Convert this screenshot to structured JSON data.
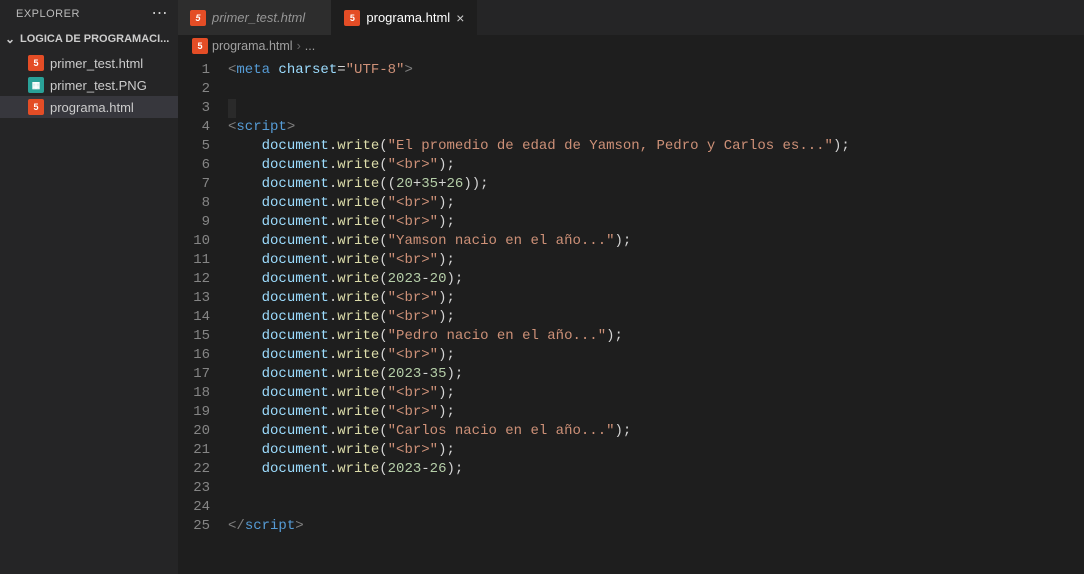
{
  "sidebar": {
    "title": "EXPLORER",
    "section": "LOGICA DE PROGRAMACI...",
    "items": [
      {
        "label": "primer_test.html",
        "icon": "html"
      },
      {
        "label": "primer_test.PNG",
        "icon": "img"
      },
      {
        "label": "programa.html",
        "icon": "html",
        "selected": true
      }
    ]
  },
  "tabs": [
    {
      "label": "primer_test.html",
      "icon": "html",
      "active": false
    },
    {
      "label": "programa.html",
      "icon": "html",
      "active": true
    }
  ],
  "breadcrumb": {
    "file": "programa.html",
    "tail": "..."
  },
  "code": {
    "lines": [
      [
        {
          "t": "punc",
          "v": "<"
        },
        {
          "t": "tag",
          "v": "meta"
        },
        {
          "t": "wh",
          "v": " "
        },
        {
          "t": "attr",
          "v": "charset"
        },
        {
          "t": "white",
          "v": "="
        },
        {
          "t": "str",
          "v": "\"UTF-8\""
        },
        {
          "t": "punc",
          "v": ">"
        }
      ],
      [],
      [
        {
          "t": "current",
          "v": ""
        }
      ],
      [
        {
          "t": "punc",
          "v": "<"
        },
        {
          "t": "tag",
          "v": "script"
        },
        {
          "t": "punc",
          "v": ">"
        }
      ],
      [
        {
          "t": "wh",
          "v": "    "
        },
        {
          "t": "obj",
          "v": "document"
        },
        {
          "t": "white",
          "v": "."
        },
        {
          "t": "func",
          "v": "write"
        },
        {
          "t": "white",
          "v": "("
        },
        {
          "t": "str",
          "v": "\"El promedio de edad de Yamson, Pedro y Carlos es...\""
        },
        {
          "t": "white",
          "v": ");"
        }
      ],
      [
        {
          "t": "wh",
          "v": "    "
        },
        {
          "t": "obj",
          "v": "document"
        },
        {
          "t": "white",
          "v": "."
        },
        {
          "t": "func",
          "v": "write"
        },
        {
          "t": "white",
          "v": "("
        },
        {
          "t": "str",
          "v": "\"<br>\""
        },
        {
          "t": "white",
          "v": ");"
        }
      ],
      [
        {
          "t": "wh",
          "v": "    "
        },
        {
          "t": "obj",
          "v": "document"
        },
        {
          "t": "white",
          "v": "."
        },
        {
          "t": "func",
          "v": "write"
        },
        {
          "t": "white",
          "v": "(("
        },
        {
          "t": "num",
          "v": "20"
        },
        {
          "t": "white",
          "v": "+"
        },
        {
          "t": "num",
          "v": "35"
        },
        {
          "t": "white",
          "v": "+"
        },
        {
          "t": "num",
          "v": "26"
        },
        {
          "t": "white",
          "v": "));"
        }
      ],
      [
        {
          "t": "wh",
          "v": "    "
        },
        {
          "t": "obj",
          "v": "document"
        },
        {
          "t": "white",
          "v": "."
        },
        {
          "t": "func",
          "v": "write"
        },
        {
          "t": "white",
          "v": "("
        },
        {
          "t": "str",
          "v": "\"<br>\""
        },
        {
          "t": "white",
          "v": ");"
        }
      ],
      [
        {
          "t": "wh",
          "v": "    "
        },
        {
          "t": "obj",
          "v": "document"
        },
        {
          "t": "white",
          "v": "."
        },
        {
          "t": "func",
          "v": "write"
        },
        {
          "t": "white",
          "v": "("
        },
        {
          "t": "str",
          "v": "\"<br>\""
        },
        {
          "t": "white",
          "v": ");"
        }
      ],
      [
        {
          "t": "wh",
          "v": "    "
        },
        {
          "t": "obj",
          "v": "document"
        },
        {
          "t": "white",
          "v": "."
        },
        {
          "t": "func",
          "v": "write"
        },
        {
          "t": "white",
          "v": "("
        },
        {
          "t": "str",
          "v": "\"Yamson nacio en el año...\""
        },
        {
          "t": "white",
          "v": ");"
        }
      ],
      [
        {
          "t": "wh",
          "v": "    "
        },
        {
          "t": "obj",
          "v": "document"
        },
        {
          "t": "white",
          "v": "."
        },
        {
          "t": "func",
          "v": "write"
        },
        {
          "t": "white",
          "v": "("
        },
        {
          "t": "str",
          "v": "\"<br>\""
        },
        {
          "t": "white",
          "v": ");"
        }
      ],
      [
        {
          "t": "wh",
          "v": "    "
        },
        {
          "t": "obj",
          "v": "document"
        },
        {
          "t": "white",
          "v": "."
        },
        {
          "t": "func",
          "v": "write"
        },
        {
          "t": "white",
          "v": "("
        },
        {
          "t": "num",
          "v": "2023"
        },
        {
          "t": "white",
          "v": "-"
        },
        {
          "t": "num",
          "v": "20"
        },
        {
          "t": "white",
          "v": ");"
        }
      ],
      [
        {
          "t": "wh",
          "v": "    "
        },
        {
          "t": "obj",
          "v": "document"
        },
        {
          "t": "white",
          "v": "."
        },
        {
          "t": "func",
          "v": "write"
        },
        {
          "t": "white",
          "v": "("
        },
        {
          "t": "str",
          "v": "\"<br>\""
        },
        {
          "t": "white",
          "v": ");"
        }
      ],
      [
        {
          "t": "wh",
          "v": "    "
        },
        {
          "t": "obj",
          "v": "document"
        },
        {
          "t": "white",
          "v": "."
        },
        {
          "t": "func",
          "v": "write"
        },
        {
          "t": "white",
          "v": "("
        },
        {
          "t": "str",
          "v": "\"<br>\""
        },
        {
          "t": "white",
          "v": ");"
        }
      ],
      [
        {
          "t": "wh",
          "v": "    "
        },
        {
          "t": "obj",
          "v": "document"
        },
        {
          "t": "white",
          "v": "."
        },
        {
          "t": "func",
          "v": "write"
        },
        {
          "t": "white",
          "v": "("
        },
        {
          "t": "str",
          "v": "\"Pedro nacio en el año...\""
        },
        {
          "t": "white",
          "v": ");"
        }
      ],
      [
        {
          "t": "wh",
          "v": "    "
        },
        {
          "t": "obj",
          "v": "document"
        },
        {
          "t": "white",
          "v": "."
        },
        {
          "t": "func",
          "v": "write"
        },
        {
          "t": "white",
          "v": "("
        },
        {
          "t": "str",
          "v": "\"<br>\""
        },
        {
          "t": "white",
          "v": ");"
        }
      ],
      [
        {
          "t": "wh",
          "v": "    "
        },
        {
          "t": "obj",
          "v": "document"
        },
        {
          "t": "white",
          "v": "."
        },
        {
          "t": "func",
          "v": "write"
        },
        {
          "t": "white",
          "v": "("
        },
        {
          "t": "num",
          "v": "2023"
        },
        {
          "t": "white",
          "v": "-"
        },
        {
          "t": "num",
          "v": "35"
        },
        {
          "t": "white",
          "v": ");"
        }
      ],
      [
        {
          "t": "wh",
          "v": "    "
        },
        {
          "t": "obj",
          "v": "document"
        },
        {
          "t": "white",
          "v": "."
        },
        {
          "t": "func",
          "v": "write"
        },
        {
          "t": "white",
          "v": "("
        },
        {
          "t": "str",
          "v": "\"<br>\""
        },
        {
          "t": "white",
          "v": ");"
        }
      ],
      [
        {
          "t": "wh",
          "v": "    "
        },
        {
          "t": "obj",
          "v": "document"
        },
        {
          "t": "white",
          "v": "."
        },
        {
          "t": "func",
          "v": "write"
        },
        {
          "t": "white",
          "v": "("
        },
        {
          "t": "str",
          "v": "\"<br>\""
        },
        {
          "t": "white",
          "v": ");"
        }
      ],
      [
        {
          "t": "wh",
          "v": "    "
        },
        {
          "t": "obj",
          "v": "document"
        },
        {
          "t": "white",
          "v": "."
        },
        {
          "t": "func",
          "v": "write"
        },
        {
          "t": "white",
          "v": "("
        },
        {
          "t": "str",
          "v": "\"Carlos nacio en el año...\""
        },
        {
          "t": "white",
          "v": ");"
        }
      ],
      [
        {
          "t": "wh",
          "v": "    "
        },
        {
          "t": "obj",
          "v": "document"
        },
        {
          "t": "white",
          "v": "."
        },
        {
          "t": "func",
          "v": "write"
        },
        {
          "t": "white",
          "v": "("
        },
        {
          "t": "str",
          "v": "\"<br>\""
        },
        {
          "t": "white",
          "v": ");"
        }
      ],
      [
        {
          "t": "wh",
          "v": "    "
        },
        {
          "t": "obj",
          "v": "document"
        },
        {
          "t": "white",
          "v": "."
        },
        {
          "t": "func",
          "v": "write"
        },
        {
          "t": "white",
          "v": "("
        },
        {
          "t": "num",
          "v": "2023"
        },
        {
          "t": "white",
          "v": "-"
        },
        {
          "t": "num",
          "v": "26"
        },
        {
          "t": "white",
          "v": ");"
        }
      ],
      [],
      [],
      [
        {
          "t": "punc",
          "v": "</"
        },
        {
          "t": "tag",
          "v": "script"
        },
        {
          "t": "punc",
          "v": ">"
        }
      ]
    ]
  }
}
